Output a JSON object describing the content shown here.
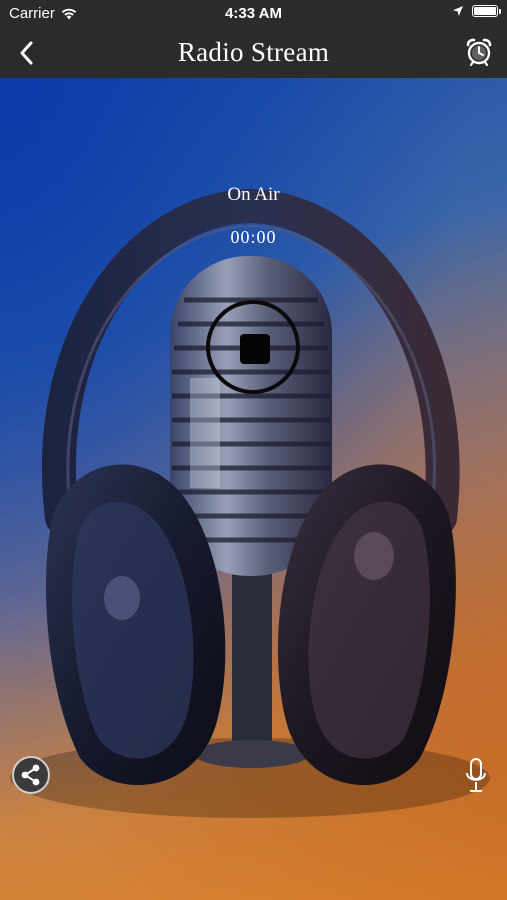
{
  "status_bar": {
    "carrier": "Carrier",
    "time": "4:33 AM",
    "wifi_icon": "wifi-icon",
    "location_icon": "location-arrow-icon",
    "battery_icon": "battery-icon"
  },
  "nav_bar": {
    "title": "Radio Stream",
    "back_icon": "chevron-left-icon",
    "alarm_icon": "alarm-clock-icon"
  },
  "player": {
    "status": "On Air",
    "elapsed": "00:00",
    "stop_icon": "stop-icon",
    "share_icon": "share-icon",
    "mic_icon": "microphone-icon",
    "background": "headphones-and-microphone-photo"
  },
  "colors": {
    "header_bg": "#2b2b2b",
    "text": "#ffffff",
    "gradient_blue": "#1a4aa8",
    "gradient_orange": "#d0762a"
  }
}
